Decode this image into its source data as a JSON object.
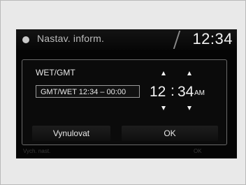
{
  "header": {
    "title": "Nastav. inform.",
    "clock": "12:34"
  },
  "background": {
    "left_hint": "Vych. nast.",
    "right_hint": "OK"
  },
  "dialog": {
    "zone_label": "WET/GMT",
    "zone_value": "GMT/WET 12:34 – 00:00",
    "time": {
      "hour": "12",
      "separator": ":",
      "minute": "34",
      "period": "AM"
    },
    "reset_label": "Vynulovat",
    "ok_label": "OK"
  },
  "icons": [
    "settings-dot-icon",
    "hour-up-arrow-icon",
    "hour-down-arrow-icon",
    "minute-up-arrow-icon",
    "minute-down-arrow-icon"
  ],
  "colors": {
    "screen_background": "#050505",
    "text": "#f2f2f2",
    "border": "#9a9a9a"
  }
}
